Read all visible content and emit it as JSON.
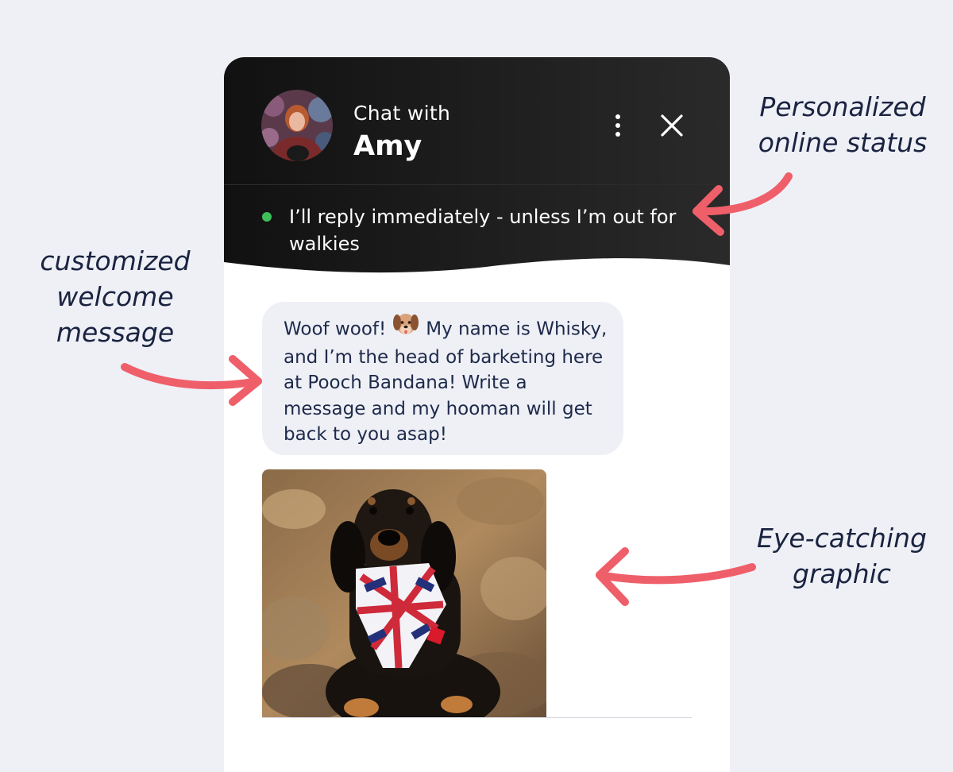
{
  "chat": {
    "title_prefix": "Chat with",
    "agent_name": "Amy",
    "status_text": "I’ll reply immediately - unless I’m out for walkies",
    "status_color": "#3fbf5a",
    "header_color": "#1a1a1a",
    "accent": "#ef5f6a"
  },
  "welcome": {
    "part1": "Woof woof!",
    "emoji": "dog-face-emoji",
    "part2": "My name is Whisky, and I’m the head of barketing here at Pooch Bandana! Write a message and my hooman will get back to you asap!"
  },
  "icons": {
    "menu": "vertical-dots-icon",
    "close": "close-icon"
  },
  "annotations": {
    "online_status": [
      "Personalized",
      "online status"
    ],
    "welcome_message": [
      "customized",
      "welcome",
      "message"
    ],
    "graphic": [
      "Eye-catching",
      "graphic"
    ]
  }
}
